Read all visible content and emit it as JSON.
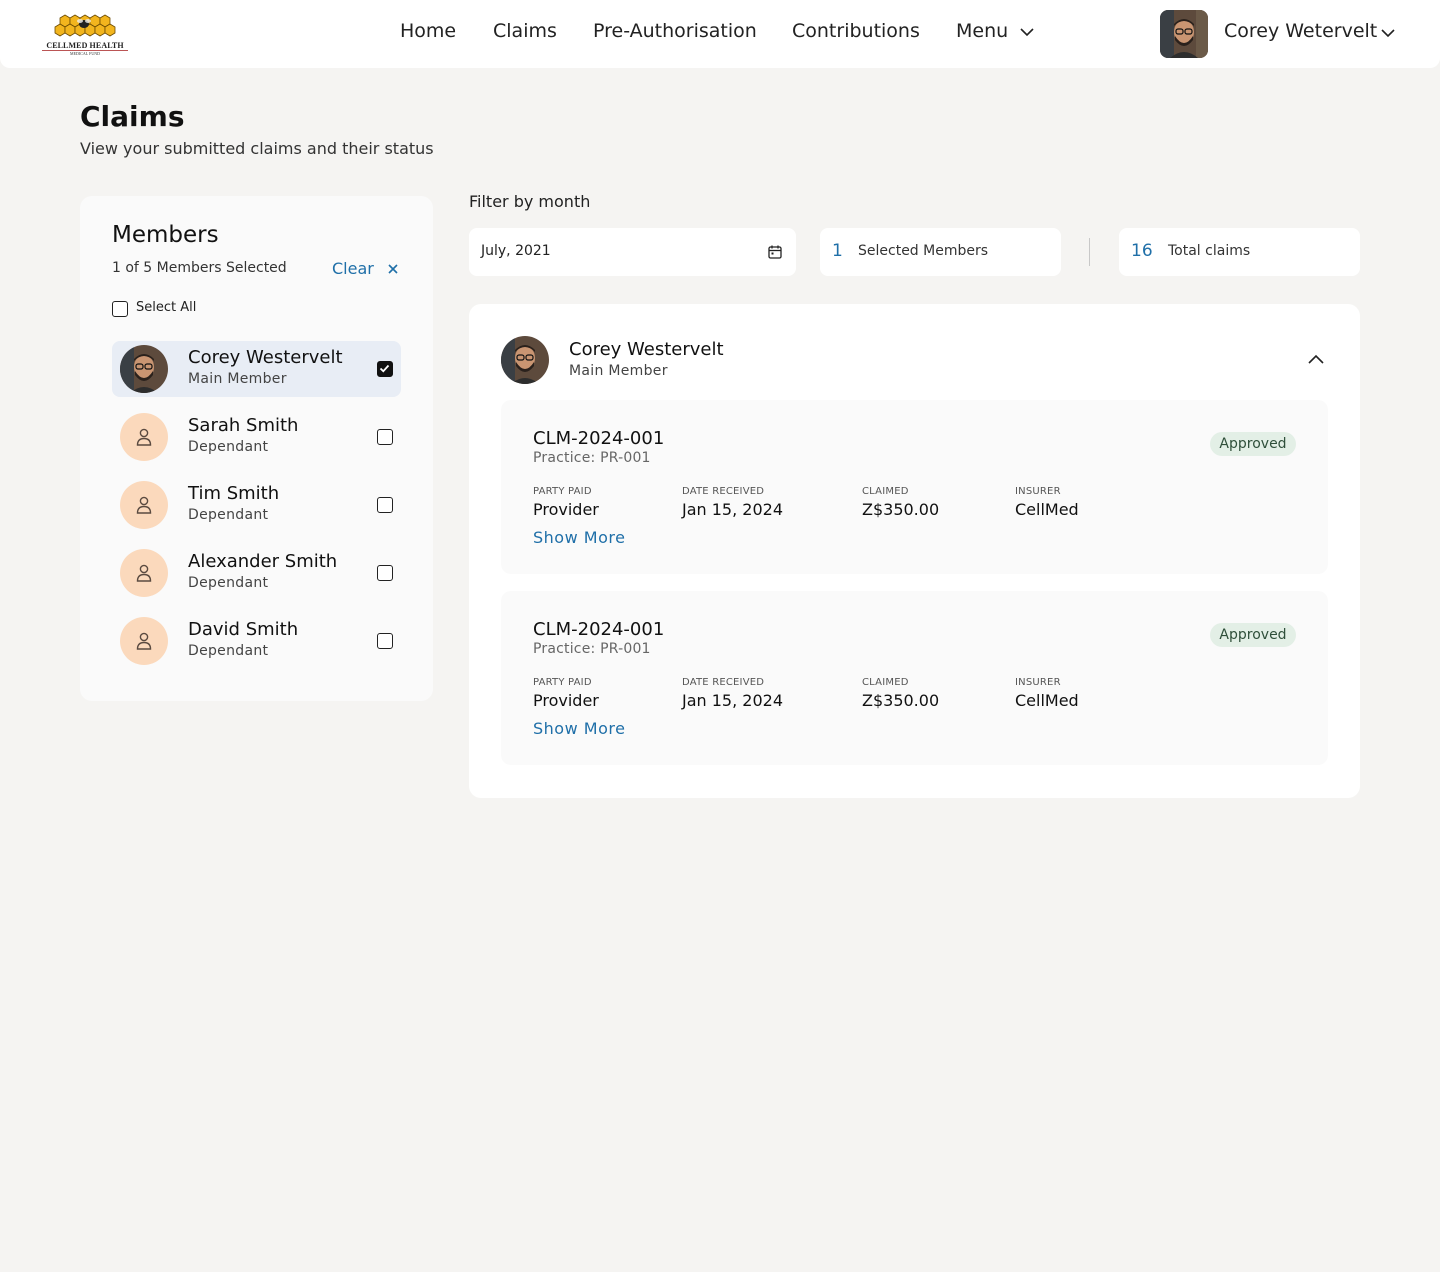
{
  "header": {
    "logo": {
      "line1": "CELLMED HEALTH",
      "line2": "MEDICAL FUND"
    },
    "nav": [
      "Home",
      "Claims",
      "Pre-Authorisation",
      "Contributions",
      "Menu"
    ],
    "user_name": "Corey Wetervelt"
  },
  "page": {
    "title": "Claims",
    "subtitle": "View your submitted claims and their status"
  },
  "members_panel": {
    "title": "Members",
    "count_text": "1 of 5 Members Selected",
    "clear_label": "Clear",
    "select_all_label": "Select All",
    "members": [
      {
        "name": "Corey Westervelt",
        "role": "Main Member",
        "checked": true,
        "avatar": "photo"
      },
      {
        "name": "Sarah Smith",
        "role": "Dependant",
        "checked": false,
        "avatar": "user-icon"
      },
      {
        "name": "Tim Smith",
        "role": "Dependant",
        "checked": false,
        "avatar": "user-icon"
      },
      {
        "name": "Alexander Smith",
        "role": "Dependant",
        "checked": false,
        "avatar": "user-icon"
      },
      {
        "name": "David Smith",
        "role": "Dependant",
        "checked": false,
        "avatar": "user-icon"
      }
    ]
  },
  "filter": {
    "label": "Filter by month",
    "month_value": "July, 2021",
    "selected_members_count": "1",
    "selected_members_label": "Selected Members",
    "total_claims_count": "16",
    "total_claims_label": "Total claims"
  },
  "claims_card": {
    "member_name": "Corey Westervelt",
    "member_role": "Main Member",
    "claims": [
      {
        "id": "CLM-2024-001",
        "practice": "Practice: PR-001",
        "status": "Approved",
        "fields": [
          {
            "label": "PARTY PAID",
            "value": "Provider"
          },
          {
            "label": "DATE RECEIVED",
            "value": "Jan 15, 2024"
          },
          {
            "label": "CLAIMED",
            "value": "Z$350.00"
          },
          {
            "label": "INSURER",
            "value": "CellMed"
          }
        ],
        "show_more": "Show More"
      },
      {
        "id": "CLM-2024-001",
        "practice": "Practice: PR-001",
        "status": "Approved",
        "fields": [
          {
            "label": "PARTY PAID",
            "value": "Provider"
          },
          {
            "label": "DATE RECEIVED",
            "value": "Jan 15, 2024"
          },
          {
            "label": "CLAIMED",
            "value": "Z$350.00"
          },
          {
            "label": "INSURER",
            "value": "CellMed"
          }
        ],
        "show_more": "Show More"
      }
    ]
  },
  "colors": {
    "background": "#f5f4f2",
    "accent_blue": "#1f6fa8",
    "selected_row": "#e8edf5",
    "avatar_placeholder": "#fbd9bc",
    "approved_badge": "#e3efe6"
  }
}
